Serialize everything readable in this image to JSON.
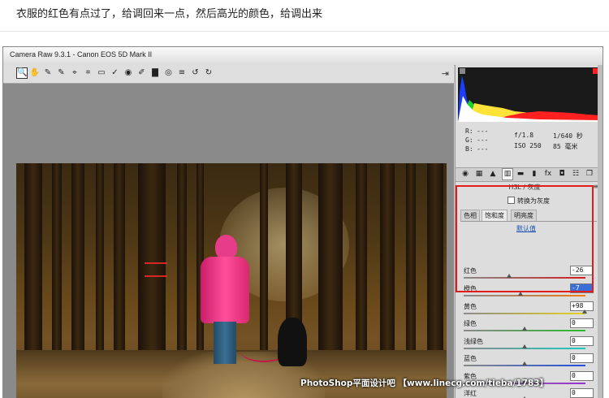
{
  "caption": "衣服的红色有点过了，给调回来一点，然后高光的颜色，给调出来",
  "window": {
    "title": "Camera Raw 9.3.1 -  Canon EOS 5D Mark II"
  },
  "toolbar": {
    "tools": [
      {
        "name": "zoom-tool-icon",
        "glyph": "🔍",
        "selected": true
      },
      {
        "name": "hand-tool-icon",
        "glyph": "✋"
      },
      {
        "name": "white-balance-tool-icon",
        "glyph": "✎"
      },
      {
        "name": "color-sampler-icon",
        "glyph": "✎"
      },
      {
        "name": "targeted-adjustment-icon",
        "glyph": "⌖"
      },
      {
        "name": "crop-tool-icon",
        "glyph": "⌗"
      },
      {
        "name": "straighten-tool-icon",
        "glyph": "▭"
      },
      {
        "name": "spot-removal-icon",
        "glyph": "✓"
      },
      {
        "name": "red-eye-icon",
        "glyph": "◉"
      },
      {
        "name": "adjustment-brush-icon",
        "glyph": "✐"
      },
      {
        "name": "graduated-filter-icon",
        "glyph": "▇"
      },
      {
        "name": "radial-filter-icon",
        "glyph": "◎"
      },
      {
        "name": "preferences-icon",
        "glyph": "≡"
      },
      {
        "name": "rotate-ccw-icon",
        "glyph": "↺"
      },
      {
        "name": "rotate-cw-icon",
        "glyph": "↻"
      }
    ],
    "exit_glyph": "⇥"
  },
  "readout": {
    "r_label": "R:",
    "r_value": "---",
    "g_label": "G:",
    "g_value": "---",
    "b_label": "B:",
    "b_value": "---",
    "aperture": "f/1.8",
    "shutter": "1/640 秒",
    "iso": "ISO 250",
    "focal": "85 毫米"
  },
  "panel_tabs": [
    {
      "name": "basic-tab-icon",
      "glyph": "◉"
    },
    {
      "name": "tone-curve-tab-icon",
      "glyph": "▦"
    },
    {
      "name": "detail-tab-icon",
      "glyph": "▲"
    },
    {
      "name": "hsl-tab-icon",
      "glyph": "▥",
      "active": true
    },
    {
      "name": "split-toning-tab-icon",
      "glyph": "▬"
    },
    {
      "name": "lens-corrections-tab-icon",
      "glyph": "▮"
    },
    {
      "name": "effects-tab-icon",
      "glyph": "fx"
    },
    {
      "name": "camera-calibration-tab-icon",
      "glyph": "◘"
    },
    {
      "name": "presets-tab-icon",
      "glyph": "☷"
    },
    {
      "name": "snapshots-tab-icon",
      "glyph": "❐"
    }
  ],
  "panel": {
    "title": "HSL / 灰度",
    "menu_glyph": "≡",
    "grayscale_label": "转换为灰度",
    "subtabs": [
      "色相",
      "饱和度",
      "明亮度"
    ],
    "active_subtab": 1,
    "default_link": "默认值"
  },
  "sliders": [
    {
      "label": "红色",
      "value": "-26",
      "level": -26,
      "gradient": "linear-gradient(90deg,#8a8a8a,#d11d1d)"
    },
    {
      "label": "橙色",
      "value": "-7",
      "level": -7,
      "gradient": "linear-gradient(90deg,#8a8a8a,#f07a10)",
      "selected": true
    },
    {
      "label": "黄色",
      "value": "+98",
      "level": 98,
      "gradient": "linear-gradient(90deg,#8a8a8a,#e8d21a)"
    },
    {
      "label": "绿色",
      "value": "0",
      "level": 0,
      "gradient": "linear-gradient(90deg,#8a8a8a,#2eb82e)"
    },
    {
      "label": "浅绿色",
      "value": "0",
      "level": 0,
      "gradient": "linear-gradient(90deg,#8a8a8a,#18c8c0)"
    },
    {
      "label": "蓝色",
      "value": "0",
      "level": 0,
      "gradient": "linear-gradient(90deg,#8a8a8a,#2050e0)"
    },
    {
      "label": "紫色",
      "value": "0",
      "level": 0,
      "gradient": "linear-gradient(90deg,#8a8a8a,#9a30d0)"
    },
    {
      "label": "洋红",
      "value": "0",
      "level": 0,
      "gradient": "linear-gradient(90deg,#8a8a8a,#e020b0)"
    }
  ],
  "watermark": "PhotoShop平面设计吧 【www.linecg.com/tieba/1783】",
  "colors": {
    "highlight_box": "#e21b1b",
    "link": "#1a4fb0",
    "selection": "#3a6ed8"
  }
}
